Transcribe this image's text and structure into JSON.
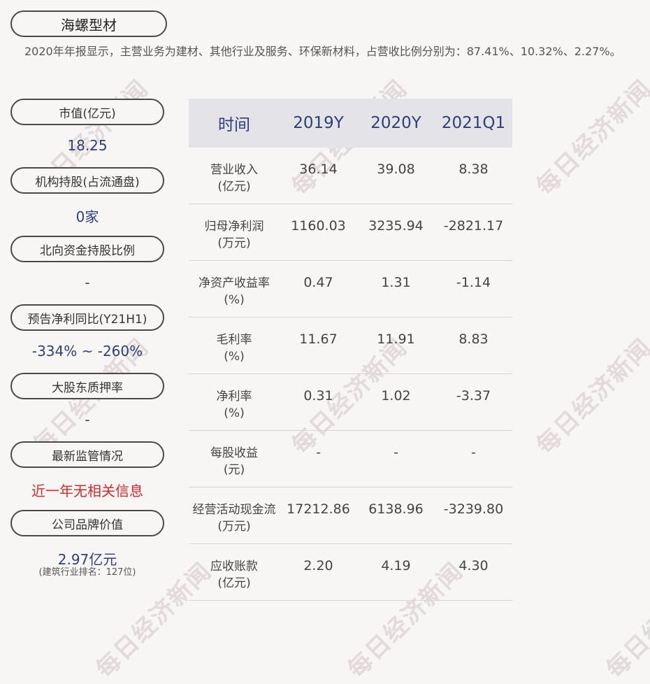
{
  "company": "海螺型材",
  "summary": "2020年年报显示，主营业务为建材、其他行业及服务、环保新材料，占营收比例分别为：87.41%、10.32%、2.27%。",
  "watermark": "每日经济新闻",
  "left": {
    "market_cap": {
      "label": "市值(亿元)",
      "value": "18.25"
    },
    "institution": {
      "label": "机构持股(占流通盘)",
      "value": "0家"
    },
    "northbound": {
      "label": "北向资金持股比例",
      "value": "-"
    },
    "forecast": {
      "label": "预告净利同比(Y21H1)",
      "value": "-334% ~ -260%"
    },
    "pledge": {
      "label": "大股东质押率",
      "value": "-"
    },
    "regulation": {
      "label": "最新监管情况",
      "value": "近一年无相关信息"
    },
    "brand": {
      "label": "公司品牌价值",
      "value": "2.97亿元",
      "note": "(建筑行业排名：127位)"
    }
  },
  "table": {
    "headers": [
      "时间",
      "2019Y",
      "2020Y",
      "2021Q1"
    ],
    "rows": [
      {
        "label1": "营业收入",
        "label2": "(亿元)",
        "v": [
          "36.14",
          "39.08",
          "8.38"
        ]
      },
      {
        "label1": "归母净利润",
        "label2": "(万元)",
        "v": [
          "1160.03",
          "3235.94",
          "-2821.17"
        ]
      },
      {
        "label1": "净资产收益率",
        "label2": "(%)",
        "v": [
          "0.47",
          "1.31",
          "-1.14"
        ]
      },
      {
        "label1": "毛利率",
        "label2": "(%)",
        "v": [
          "11.67",
          "11.91",
          "8.83"
        ]
      },
      {
        "label1": "净利率",
        "label2": "(%)",
        "v": [
          "0.31",
          "1.02",
          "-3.37"
        ]
      },
      {
        "label1": "每股收益",
        "label2": "(元)",
        "v": [
          "-",
          "-",
          "-"
        ]
      },
      {
        "label1": "经营活动现金流",
        "label2": "(万元)",
        "v": [
          "17212.86",
          "6138.96",
          "-3239.80"
        ]
      },
      {
        "label1": "应收账款",
        "label2": "(亿元)",
        "v": [
          "2.20",
          "4.19",
          "4.30"
        ]
      }
    ]
  },
  "colors": {
    "accent": "#2e3f7a",
    "alert": "#d12b2b",
    "header_bg": "#e4e3e7"
  }
}
